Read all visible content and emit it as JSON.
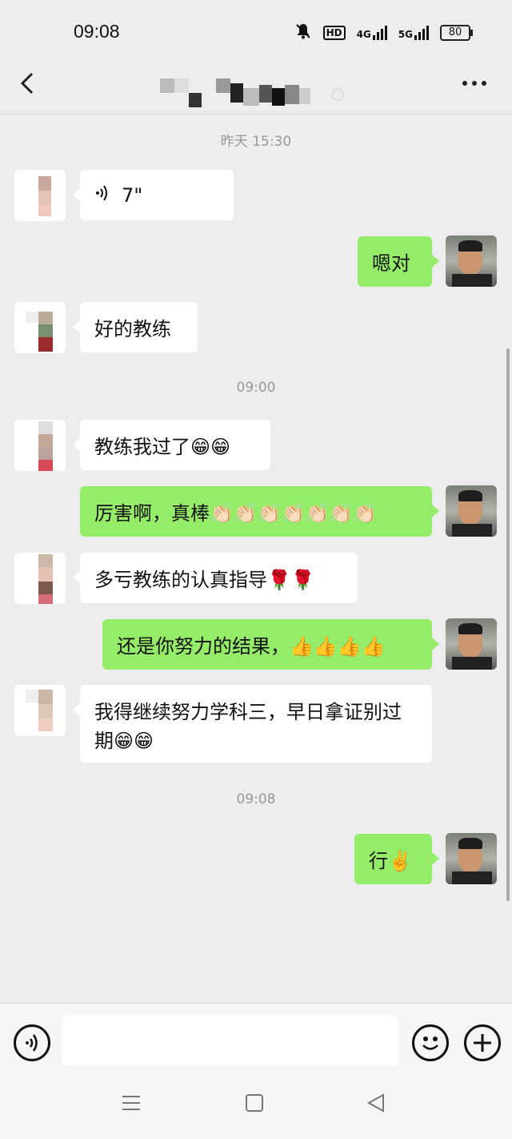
{
  "status_bar": {
    "time": "09:08",
    "icons": [
      "mute-bell-icon",
      "hd-icon",
      "4g-signal-icon",
      "5g-signal-icon"
    ],
    "hd_label": "HD",
    "net4g": "4G",
    "net5g": "5G",
    "battery": "80"
  },
  "header": {
    "back_icon": "chevron-left-icon",
    "title": "",
    "more_icon": "more-dots-icon"
  },
  "messages": [
    {
      "type": "timestamp",
      "text": "昨天 15:30"
    },
    {
      "type": "voice",
      "side": "in",
      "duration": "7\""
    },
    {
      "type": "text",
      "side": "out",
      "text": "嗯对"
    },
    {
      "type": "text",
      "side": "in",
      "text": "好的教练"
    },
    {
      "type": "timestamp",
      "text": "09:00"
    },
    {
      "type": "text",
      "side": "in",
      "text": "教练我过了😁😁"
    },
    {
      "type": "text",
      "side": "out",
      "text": "厉害啊，真棒👏🏻👏🏻👏🏻👏🏻👏🏻👏🏻👏🏻"
    },
    {
      "type": "text",
      "side": "in",
      "text": "多亏教练的认真指导🌹🌹"
    },
    {
      "type": "text",
      "side": "out",
      "text": "还是你努力的结果，👍👍👍👍"
    },
    {
      "type": "text",
      "side": "in",
      "text": "我得继续努力学科三，早日拿证别过期😁😁"
    },
    {
      "type": "timestamp",
      "text": "09:08"
    },
    {
      "type": "text",
      "side": "out",
      "text": "行✌️"
    }
  ],
  "input_bar": {
    "voice_icon": "voice-input-icon",
    "emoji_icon": "emoji-icon",
    "plus_icon": "plus-icon",
    "placeholder": ""
  },
  "system_nav": {
    "menu_icon": "menu-icon",
    "home_icon": "home-square-icon",
    "back_icon": "back-triangle-icon"
  },
  "colors": {
    "background": "#ededed",
    "bubble_out": "#95ec69",
    "bubble_in": "#ffffff"
  }
}
